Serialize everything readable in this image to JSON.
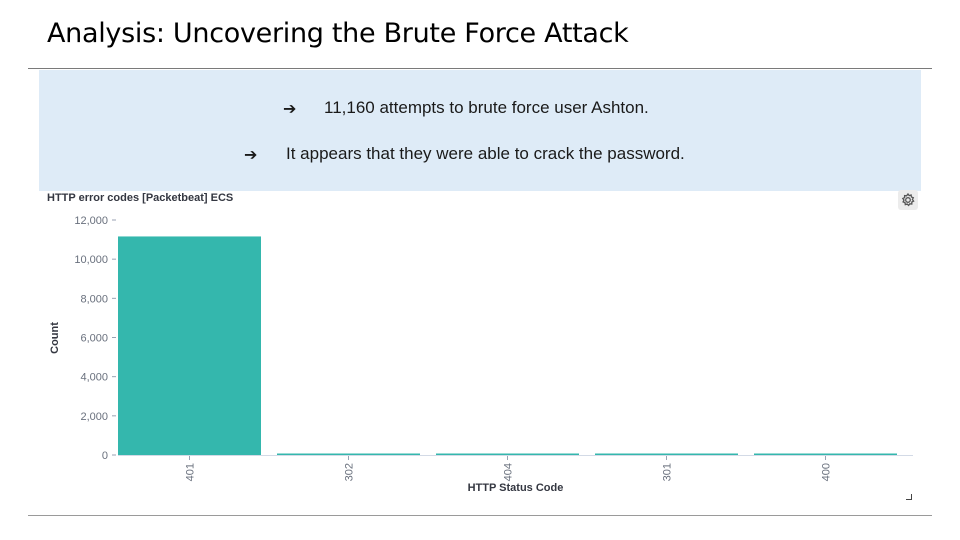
{
  "slide": {
    "title": "Analysis: Uncovering the Brute Force Attack"
  },
  "callout": {
    "bullets": [
      {
        "marker": "➔",
        "text": "11,160 attempts to brute force user Ashton."
      },
      {
        "marker": "➔",
        "text": "It appears that they were able to crack the password."
      }
    ]
  },
  "icons": {
    "settings": "gear-icon"
  },
  "colors": {
    "bar": "#34b7ad",
    "callout_background": "#deebf7",
    "axis_text": "#69707d"
  },
  "chart_data": {
    "type": "bar",
    "title": "HTTP error codes [Packetbeat] ECS",
    "xlabel": "HTTP Status Code",
    "ylabel": "Count",
    "categories": [
      "401",
      "302",
      "404",
      "301",
      "400"
    ],
    "values": [
      11160,
      40,
      30,
      15,
      5
    ],
    "ylim": [
      0,
      12000
    ],
    "yticks": [
      0,
      2000,
      4000,
      6000,
      8000,
      10000,
      12000
    ],
    "ytick_labels": [
      "0",
      "2,000",
      "4,000",
      "6,000",
      "8,000",
      "10,000",
      "12,000"
    ],
    "grid": false,
    "legend": "none"
  }
}
